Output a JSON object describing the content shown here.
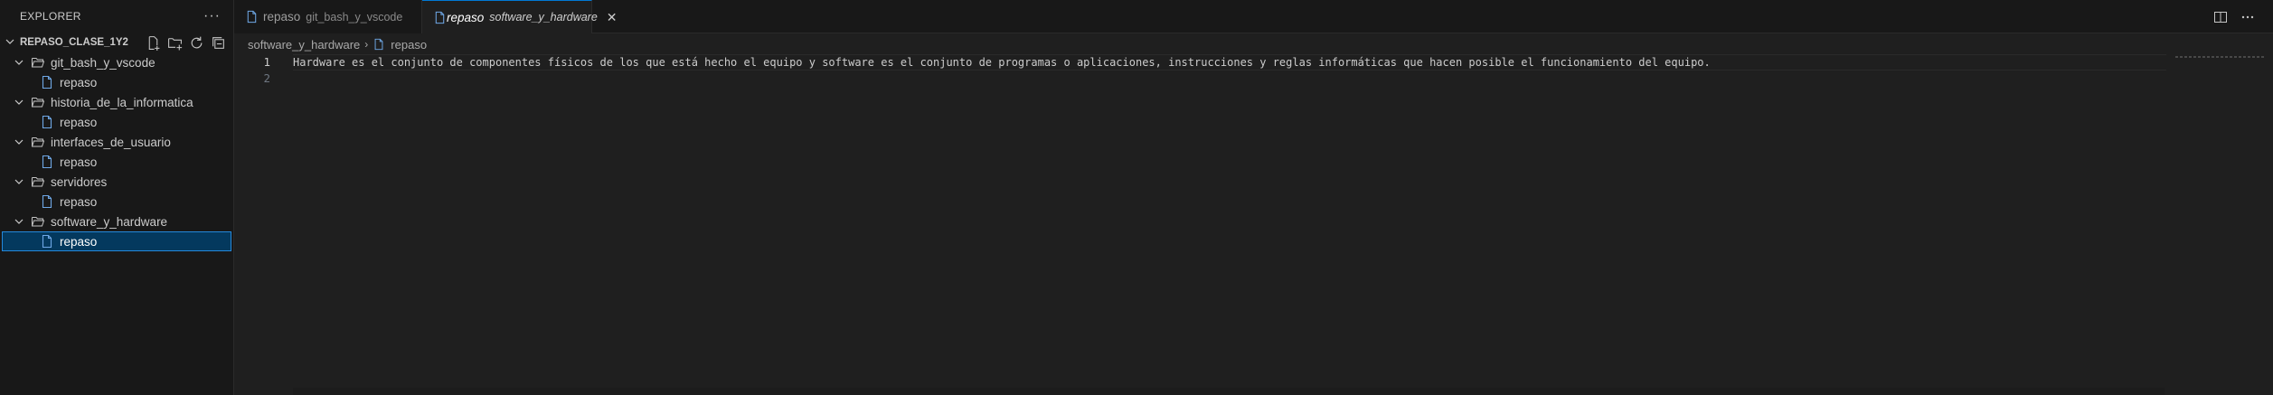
{
  "sidebar": {
    "title": "EXPLORER",
    "more_label": "···",
    "root_label": "REPASO_CLASE_1Y2",
    "folders": [
      {
        "name": "git_bash_y_vscode",
        "files": [
          "repaso"
        ]
      },
      {
        "name": "historia_de_la_informatica",
        "files": [
          "repaso"
        ]
      },
      {
        "name": "interfaces_de_usuario",
        "files": [
          "repaso"
        ]
      },
      {
        "name": "servidores",
        "files": [
          "repaso"
        ]
      },
      {
        "name": "software_y_hardware",
        "files": [
          "repaso"
        ]
      }
    ],
    "selected_folder": "software_y_hardware",
    "selected_file": "repaso"
  },
  "tabs": [
    {
      "name": "repaso",
      "description": "git_bash_y_vscode",
      "active": false
    },
    {
      "name": "repaso",
      "description": "software_y_hardware",
      "active": true,
      "close": "✕"
    }
  ],
  "breadcrumb": {
    "folder": "software_y_hardware",
    "separator": "›",
    "file": "repaso"
  },
  "editor": {
    "line_numbers": [
      "1",
      "2"
    ],
    "lines": [
      "Hardware es el conjunto de componentes físicos de los que está hecho el equipo y software es el conjunto de programas o aplicaciones, instrucciones y reglas informáticas que hacen posible el funcionamiento del equipo.",
      ""
    ]
  },
  "icons": {
    "file": "file-icon",
    "folder_open": "folder-open-icon",
    "chevron": "chevron-down-icon",
    "new_file": "new-file-icon",
    "new_folder": "new-folder-icon",
    "refresh": "refresh-icon",
    "collapse": "collapse-all-icon",
    "split": "split-editor-icon",
    "more": "more-icon"
  },
  "colors": {
    "accent": "#0078d4",
    "file_icon": "#6fa8e6",
    "selection_bg": "#04395e"
  }
}
